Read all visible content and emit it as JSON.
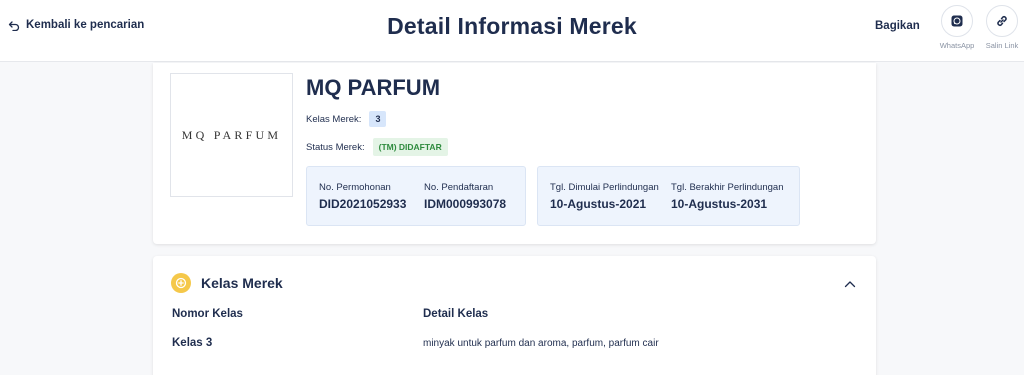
{
  "header": {
    "back_label": "Kembali ke pencarian",
    "title": "Detail Informasi Merek",
    "share_label": "Bagikan",
    "share_options": [
      {
        "label": "WhatsApp",
        "icon": "whatsapp-icon"
      },
      {
        "label": "Salin Link",
        "icon": "link-icon"
      }
    ]
  },
  "brand": {
    "logo_text": "MQ PARFUM",
    "name": "MQ PARFUM",
    "class_label": "Kelas Merek:",
    "class_value": "3",
    "status_label": "Status Merek:",
    "status_value": "(TM) DIDAFTAR",
    "status_color": "#2e8b3e"
  },
  "registration": {
    "application_no_label": "No. Permohonan",
    "application_no": "DID2021052933",
    "registration_no_label": "No. Pendaftaran",
    "registration_no": "IDM000993078"
  },
  "protection": {
    "start_label": "Tgl. Dimulai Perlindungan",
    "start": "10-Agustus-2021",
    "end_label": "Tgl. Berakhir Perlindungan",
    "end": "10-Agustus-2031"
  },
  "classes_section": {
    "title": "Kelas Merek",
    "col_number": "Nomor Kelas",
    "col_detail": "Detail Kelas",
    "rows": [
      {
        "number": "Kelas 3",
        "detail": "minyak untuk parfum dan aroma, parfum, parfum cair"
      }
    ]
  },
  "colors": {
    "text_primary": "#1f2d4e",
    "accent_yellow": "#f5c84a",
    "info_box_bg": "#eef4fd"
  }
}
